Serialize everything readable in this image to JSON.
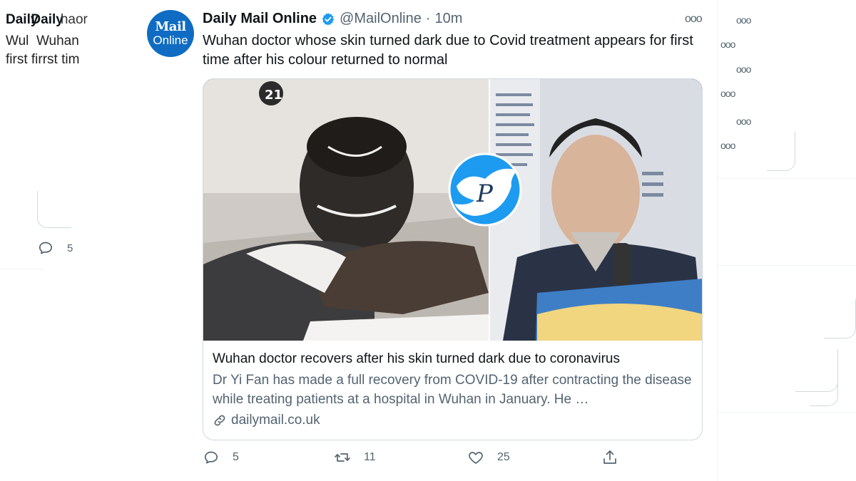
{
  "left_tweet": {
    "name": "Daily",
    "name_ghost": "Daily",
    "name_ghost2": "haor",
    "line1a": "Wul",
    "line1b": "Wuhan",
    "line2a": "first",
    "line2b": "firrst tim",
    "reply_count": "5"
  },
  "tweet": {
    "avatar_line1": "Mail",
    "avatar_line2": "Online",
    "display_name": "Daily Mail Online",
    "handle": "@MailOnline",
    "separator": "·",
    "time": "10m",
    "text": "Wuhan doctor whose skin turned dark due to Covid treatment appears for first time after his colour returned to normal",
    "card": {
      "title": "Wuhan doctor recovers after his skin turned dark due to coronavirus",
      "description": "Dr Yi Fan has made a full recovery from COVID-19 after contracting the disease while treating patients at a hospital in Wuhan in January. He …",
      "domain": "dailymail.co.uk"
    },
    "actions": {
      "reply_count": "5",
      "retweet_count": "11",
      "like_count": "25"
    }
  },
  "icons": [
    "verified-badge-icon",
    "more-options-icon",
    "reply-icon",
    "retweet-icon",
    "like-icon",
    "share-icon",
    "link-icon",
    "twitter-bird-icon"
  ],
  "colors": {
    "accent": "#1d9bf0",
    "mail_online_blue": "#0f6cc2",
    "secondary_text": "#536471",
    "border": "#cfd9de"
  }
}
